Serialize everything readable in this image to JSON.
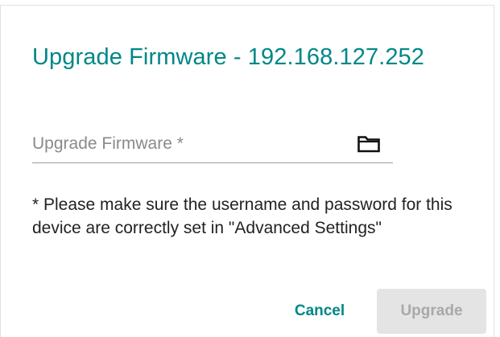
{
  "dialog": {
    "title": "Upgrade Firmware - 192.168.127.252",
    "field": {
      "placeholder": "Upgrade Firmware *",
      "value": "",
      "browse_icon": "folder-icon"
    },
    "note": "* Please make sure the username and password for this device are correctly set in \"Advanced Settings\"",
    "actions": {
      "cancel_label": "Cancel",
      "upgrade_label": "Upgrade",
      "upgrade_disabled": true
    }
  },
  "colors": {
    "accent": "#008787",
    "disabled_bg": "#e4e4e4",
    "disabled_text": "#a9a9a9"
  }
}
